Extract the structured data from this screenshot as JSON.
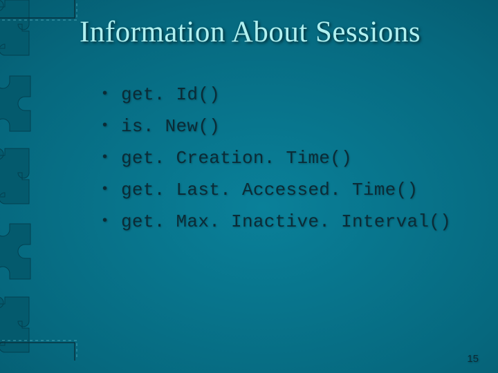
{
  "title": "Information About Sessions",
  "bullets": [
    "get. Id()",
    "is. New()",
    "get. Creation. Time()",
    "get. Last. Accessed. Time()",
    "get. Max. Inactive. Interval()"
  ],
  "page_number": "15"
}
